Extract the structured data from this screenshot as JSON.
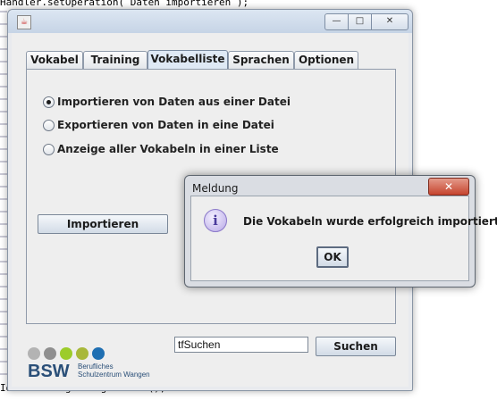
{
  "background_code": {
    "top_line": "Handler.setOperation( Daten importieren );",
    "bottom_line": "IdV   derManager.zugebenIDV();"
  },
  "window": {
    "buttons": {
      "minimize": "—",
      "maximize": "□",
      "close": "✕"
    }
  },
  "tabs": [
    {
      "label": "Vokabel"
    },
    {
      "label": "Training"
    },
    {
      "label": "Vokabelliste"
    },
    {
      "label": "Sprachen"
    },
    {
      "label": "Optionen"
    }
  ],
  "active_tab": "Vokabelliste",
  "options": [
    {
      "label": "Importieren von Daten aus einer Datei",
      "selected": true
    },
    {
      "label": "Exportieren von Daten in eine Datei",
      "selected": false
    },
    {
      "label": "Anzeige aller Vokabeln in einer Liste",
      "selected": false
    }
  ],
  "action_button": "Importieren",
  "logo": {
    "text": "BSW",
    "sub_line1": "Berufliches",
    "sub_line2": "Schulzentrum Wangen",
    "dot_colors": [
      "#b3b3b3",
      "#8f8f8f",
      "#9ccc2a",
      "#a8b83a",
      "#1f6fb2"
    ]
  },
  "search": {
    "value": "tfSuchen",
    "button": "Suchen"
  },
  "dialog": {
    "title": "Meldung",
    "message": "Die Vokabeln wurde erfolgreich importiert!",
    "ok_label": "OK",
    "close": "✕"
  }
}
